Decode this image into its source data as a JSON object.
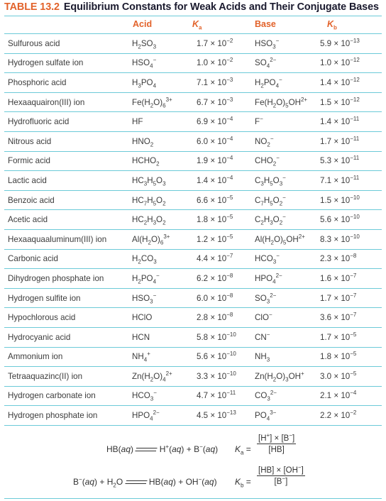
{
  "title": {
    "number": "TABLE 13.2",
    "text": "Equilibrium Constants for Weak Acids and Their Conjugate Bases"
  },
  "headers": {
    "acid": "Acid",
    "ka": "K",
    "ka_sub": "a",
    "base": "Base",
    "kb": "K",
    "kb_sub": "b"
  },
  "rows": [
    {
      "name": "Sulfurous acid",
      "acid": "H<sub>2</sub>SO<sub>3</sub>",
      "ka": "1.7 × 10<sup>−2</sup>",
      "base": "HSO<sub>3</sub><sup>−</sup>",
      "kb": "5.9 × 10<sup>−13</sup>"
    },
    {
      "name": "Hydrogen sulfate ion",
      "acid": "HSO<sub>4</sub><sup>−</sup>",
      "ka": "1.0 × 10<sup>−2</sup>",
      "base": "SO<sub>4</sub><sup>2−</sup>",
      "kb": "1.0 × 10<sup>−12</sup>"
    },
    {
      "name": "Phosphoric acid",
      "acid": "H<sub>3</sub>PO<sub>4</sub>",
      "ka": "7.1 × 10<sup>−3</sup>",
      "base": "H<sub>2</sub>PO<sub>4</sub><sup>−</sup>",
      "kb": "1.4 × 10<sup>−12</sup>"
    },
    {
      "name": "Hexaaquairon(III) ion",
      "acid": "Fe(H<sub>2</sub>O)<sub>6</sub><sup>3+</sup>",
      "ka": "6.7 × 10<sup>−3</sup>",
      "base": "Fe(H<sub>2</sub>O)<sub>5</sub>OH<sup>2+</sup>",
      "kb": "1.5 × 10<sup>−12</sup>"
    },
    {
      "name": "Hydrofluoric acid",
      "acid": "HF",
      "ka": "6.9 × 10<sup>−4</sup>",
      "base": "F<sup>−</sup>",
      "kb": "1.4 × 10<sup>−11</sup>"
    },
    {
      "name": "Nitrous acid",
      "acid": "HNO<sub>2</sub>",
      "ka": "6.0 × 10<sup>−4</sup>",
      "base": "NO<sub>2</sub><sup>−</sup>",
      "kb": "1.7 × 10<sup>−11</sup>"
    },
    {
      "name": "Formic acid",
      "acid": "HCHO<sub>2</sub>",
      "ka": "1.9 × 10<sup>−4</sup>",
      "base": "CHO<sub>2</sub><sup>−</sup>",
      "kb": "5.3 × 10<sup>−11</sup>"
    },
    {
      "name": "Lactic acid",
      "acid": "HC<sub>3</sub>H<sub>5</sub>O<sub>3</sub>",
      "ka": "1.4 × 10<sup>−4</sup>",
      "base": "C<sub>3</sub>H<sub>5</sub>O<sub>3</sub><sup>−</sup>",
      "kb": "7.1 × 10<sup>−11</sup>"
    },
    {
      "name": "Benzoic acid",
      "acid": "HC<sub>7</sub>H<sub>5</sub>O<sub>2</sub>",
      "ka": "6.6 × 10<sup>−5</sup>",
      "base": "C<sub>7</sub>H<sub>5</sub>O<sub>2</sub><sup>−</sup>",
      "kb": "1.5 × 10<sup>−10</sup>"
    },
    {
      "name": "Acetic acid",
      "acid": "HC<sub>2</sub>H<sub>3</sub>O<sub>2</sub>",
      "ka": "1.8 × 10<sup>−5</sup>",
      "base": "C<sub>2</sub>H<sub>3</sub>O<sub>2</sub><sup>−</sup>",
      "kb": "5.6 × 10<sup>−10</sup>"
    },
    {
      "name": "Hexaaquaaluminum(III) ion",
      "acid": "Al(H<sub>2</sub>O)<sub>6</sub><sup>3+</sup>",
      "ka": "1.2 × 10<sup>−5</sup>",
      "base": "Al(H<sub>2</sub>O)<sub>5</sub>OH<sup>2+</sup>",
      "kb": "8.3 × 10<sup>−10</sup>"
    },
    {
      "name": "Carbonic acid",
      "acid": "H<sub>2</sub>CO<sub>3</sub>",
      "ka": "4.4 × 10<sup>−7</sup>",
      "base": "HCO<sub>3</sub><sup>−</sup>",
      "kb": "2.3 × 10<sup>−8</sup>"
    },
    {
      "name": "Dihydrogen phosphate ion",
      "acid": "H<sub>2</sub>PO<sub>4</sub><sup>−</sup>",
      "ka": "6.2 × 10<sup>−8</sup>",
      "base": "HPO<sub>4</sub><sup>2−</sup>",
      "kb": "1.6 × 10<sup>−7</sup>"
    },
    {
      "name": "Hydrogen sulfite ion",
      "acid": "HSO<sub>3</sub><sup>−</sup>",
      "ka": "6.0 × 10<sup>−8</sup>",
      "base": "SO<sub>3</sub><sup>2−</sup>",
      "kb": "1.7 × 10<sup>−7</sup>"
    },
    {
      "name": "Hypochlorous acid",
      "acid": "HClO",
      "ka": "2.8 × 10<sup>−8</sup>",
      "base": "ClO<sup>−</sup>",
      "kb": "3.6 × 10<sup>−7</sup>"
    },
    {
      "name": "Hydrocyanic acid",
      "acid": "HCN",
      "ka": "5.8 × 10<sup>−10</sup>",
      "base": "CN<sup>−</sup>",
      "kb": "1.7 × 10<sup>−5</sup>"
    },
    {
      "name": "Ammonium ion",
      "acid": "NH<sub>4</sub><sup>+</sup>",
      "ka": "5.6 × 10<sup>−10</sup>",
      "base": "NH<sub>3</sub>",
      "kb": "1.8 × 10<sup>−5</sup>"
    },
    {
      "name": "Tetraaquazinc(II) ion",
      "acid": "Zn(H<sub>2</sub>O)<sub>4</sub><sup>2+</sup>",
      "ka": "3.3 × 10<sup>−10</sup>",
      "base": "Zn(H<sub>2</sub>O)<sub>3</sub>OH<sup>+</sup>",
      "kb": "3.0 × 10<sup>−5</sup>"
    },
    {
      "name": "Hydrogen carbonate ion",
      "acid": "HCO<sub>3</sub><sup>−</sup>",
      "ka": "4.7 × 10<sup>−11</sup>",
      "base": "CO<sub>3</sub><sup>2−</sup>",
      "kb": "2.1 × 10<sup>−4</sup>"
    },
    {
      "name": "Hydrogen phosphate ion",
      "acid": "HPO<sub>4</sub><sup>2−</sup>",
      "ka": "4.5 × 10<sup>−13</sup>",
      "base": "PO<sub>4</sub><sup>3−</sup>",
      "kb": "2.2 × 10<sup>−2</sup>"
    }
  ],
  "equations": {
    "acid_eq_left": "HB(<i>aq</i>)",
    "acid_eq_right": "H<sup>+</sup>(<i>aq</i>) + B<sup>−</sup>(<i>aq</i>)",
    "base_eq_left": "B<sup>−</sup>(<i>aq</i>) + H<sub>2</sub>O",
    "base_eq_right": "HB(<i>aq</i>) + OH<sup>−</sup>(<i>aq</i>)",
    "ka_label": "<i>K</i><sub>a</sub> =",
    "ka_numerator": "[H<sup>+</sup>] × [B<sup>−</sup>]",
    "ka_denominator": "[HB]",
    "kb_label": "<i>K</i><sub>b</sub> =",
    "kb_numerator": "[HB] × [OH<sup>−</sup>]",
    "kb_denominator": "[B<sup>−</sup>]"
  },
  "colors": {
    "accent": "#e2622a",
    "rule": "#6ccad8",
    "title": "#1a1a2e"
  }
}
